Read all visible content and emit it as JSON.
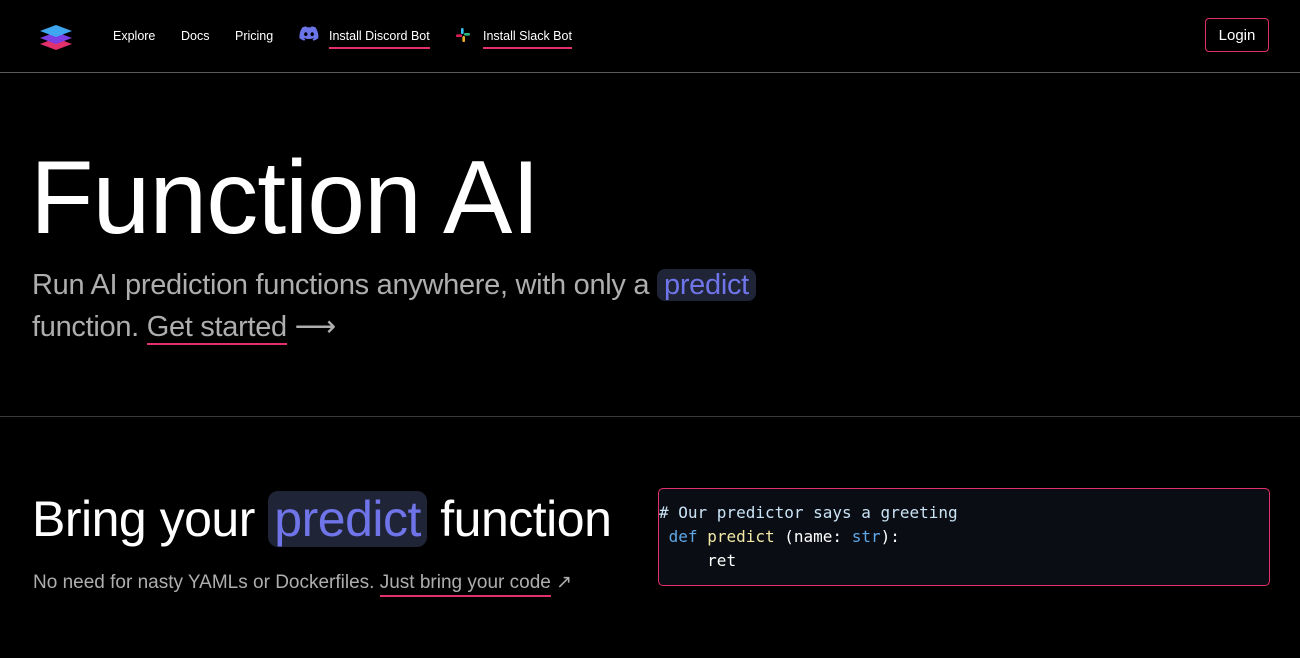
{
  "nav": {
    "links": [
      "Explore",
      "Docs",
      "Pricing"
    ],
    "discord_label": "Install Discord Bot",
    "slack_label": "Install Slack Bot",
    "login_label": "Login"
  },
  "hero": {
    "title": "Function AI",
    "sub_part1": "Run AI prediction functions anywhere, with only a",
    "pill": "predict",
    "sub_part2": "function.",
    "cta": "Get started",
    "arrow": "⟶"
  },
  "section": {
    "title_part1": "Bring your",
    "pill": "predict",
    "title_part2": "function",
    "sub": "No need for nasty YAMLs or Dockerfiles.",
    "cta": "Just bring your code",
    "arrow": "↗"
  },
  "code": {
    "comment": "# Our predictor says a greeting",
    "kw_def": "def",
    "fn_name": "predict",
    "params_open": " (name: ",
    "param_type": "str",
    "params_close": "):",
    "body": "ret"
  },
  "colors": {
    "accent": "#e1306c",
    "pill_bg": "#1f2437",
    "pill_text": "#6f75e8"
  }
}
